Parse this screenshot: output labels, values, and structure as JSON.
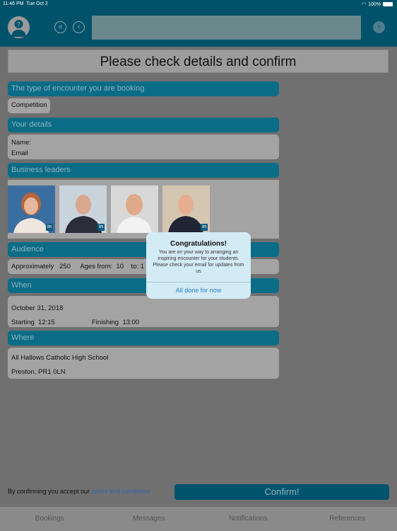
{
  "status": {
    "time": "11:46 PM",
    "date": "Tue Oct 2",
    "battery": "100%"
  },
  "header": {
    "search_value": ""
  },
  "title": "Please check details and  confirm",
  "encounter": {
    "header": "The type of encounter you are booking",
    "value": "Competition"
  },
  "details": {
    "header": "Your details",
    "name_label": "Name:",
    "email_label": "Email"
  },
  "leaders": {
    "header": "Business leaders",
    "badge": "in"
  },
  "audience": {
    "header": "Audience",
    "approx_label": "Approximately",
    "approx_value": "250",
    "ages_label": "Ages from:",
    "ages_from": "10",
    "to_label": "to:",
    "to_value": "1"
  },
  "when": {
    "header": "When",
    "date": "October 31, 2018",
    "start_label": "Starting",
    "start": "12:15",
    "finish_label": "Finishing",
    "finish": "13:00"
  },
  "where": {
    "header": "Where",
    "school": "All Hallows Catholic High School",
    "location": "Preston, PR1 0LN"
  },
  "dialog": {
    "title": "Congratulations!",
    "message": "You are on your way to arranging an inspiring encounter for your students. Please check your email for updates from us",
    "button": "All done for now"
  },
  "footer": {
    "text": "By confirming you accept our",
    "link": "terms and conditions",
    "confirm": "Confirm!"
  },
  "tabs": [
    "Bookings",
    "Messages",
    "Notifications",
    "References"
  ]
}
